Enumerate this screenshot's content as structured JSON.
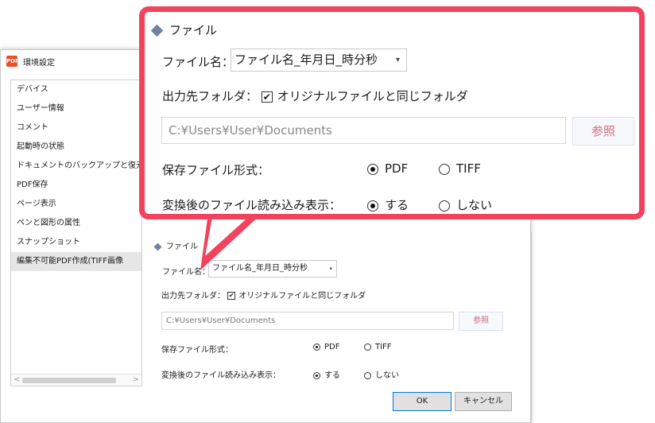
{
  "window": {
    "title": "環境設定",
    "app_icon_label": "PDF"
  },
  "sidebar": {
    "items": [
      {
        "label": "デバイス"
      },
      {
        "label": "ユーザー情報"
      },
      {
        "label": "コメント"
      },
      {
        "label": "起動時の状態"
      },
      {
        "label": "ドキュメントのバックアップと復元"
      },
      {
        "label": "PDF保存"
      },
      {
        "label": "ページ表示"
      },
      {
        "label": "ペンと図形の属性"
      },
      {
        "label": "スナップショット"
      },
      {
        "label": "編集不可能PDF作成(TIFF画像"
      }
    ],
    "active_index": 9
  },
  "settings": {
    "section_title": "ファイル",
    "filename_label": "ファイル名：",
    "filename_value": "ファイル名_年月日_時分秒",
    "output_folder_label": "出力先フォルダ：",
    "same_folder_label": "オリジナルファイルと同じフォルダ",
    "same_folder_checked": "✔",
    "path_value": "C:¥Users¥User¥Documents",
    "browse_label": "参照",
    "format_label": "保存ファイル形式：",
    "format_options": [
      "PDF",
      "TIFF"
    ],
    "format_selected": "PDF",
    "show_after_label": "変換後のファイル読み込み表示：",
    "show_after_options": [
      "する",
      "しない"
    ],
    "show_after_selected": "する"
  },
  "footer": {
    "ok_label": "OK",
    "cancel_label": "キャンセル"
  },
  "icons": {
    "caret": "▾",
    "scroll_left": "<",
    "scroll_right": ">"
  },
  "colors": {
    "callout_border": "#f2425e",
    "browse_text": "#d46d86",
    "diamond": "#6f84a3"
  }
}
